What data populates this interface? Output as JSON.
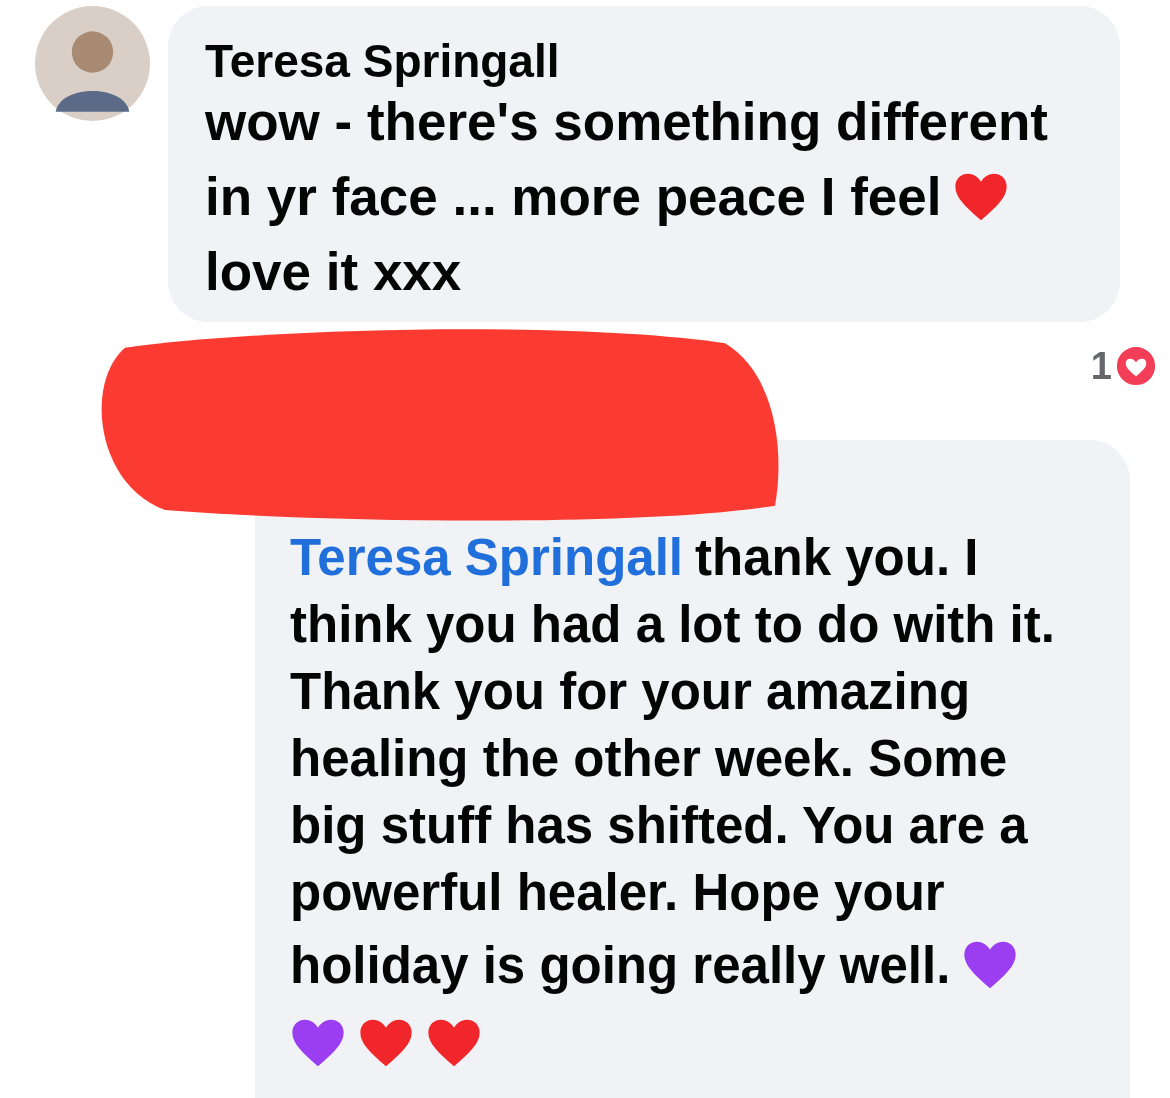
{
  "comment": {
    "author": "Teresa Springall",
    "lines": [
      [
        {
          "kind": "text",
          "text": "wow - there's something different"
        }
      ],
      [
        {
          "kind": "text",
          "text": "in yr face ... more peace I feel"
        },
        {
          "kind": "heart",
          "color": "#f0262a"
        }
      ],
      [
        {
          "kind": "text",
          "text": "love it xxx"
        }
      ]
    ]
  },
  "reaction": {
    "count": "1"
  },
  "reply": {
    "lines": [
      [
        {
          "kind": "mention",
          "text": "Teresa Springall"
        },
        {
          "kind": "text",
          "text": "thank you. I"
        }
      ],
      [
        {
          "kind": "text",
          "text": "think you had a lot to do with it."
        }
      ],
      [
        {
          "kind": "text",
          "text": "Thank you for your amazing"
        }
      ],
      [
        {
          "kind": "text",
          "text": "healing the other week. Some"
        }
      ],
      [
        {
          "kind": "text",
          "text": "big stuff has shifted. You are a"
        }
      ],
      [
        {
          "kind": "text",
          "text": "powerful healer. Hope your"
        }
      ],
      [
        {
          "kind": "text",
          "text": "holiday is going really well."
        },
        {
          "kind": "heart",
          "color": "#9b3df0"
        }
      ],
      [
        {
          "kind": "heart",
          "color": "#9b3df0"
        },
        {
          "kind": "heart",
          "color": "#f0262a"
        },
        {
          "kind": "heart",
          "color": "#f0262a"
        }
      ]
    ]
  }
}
